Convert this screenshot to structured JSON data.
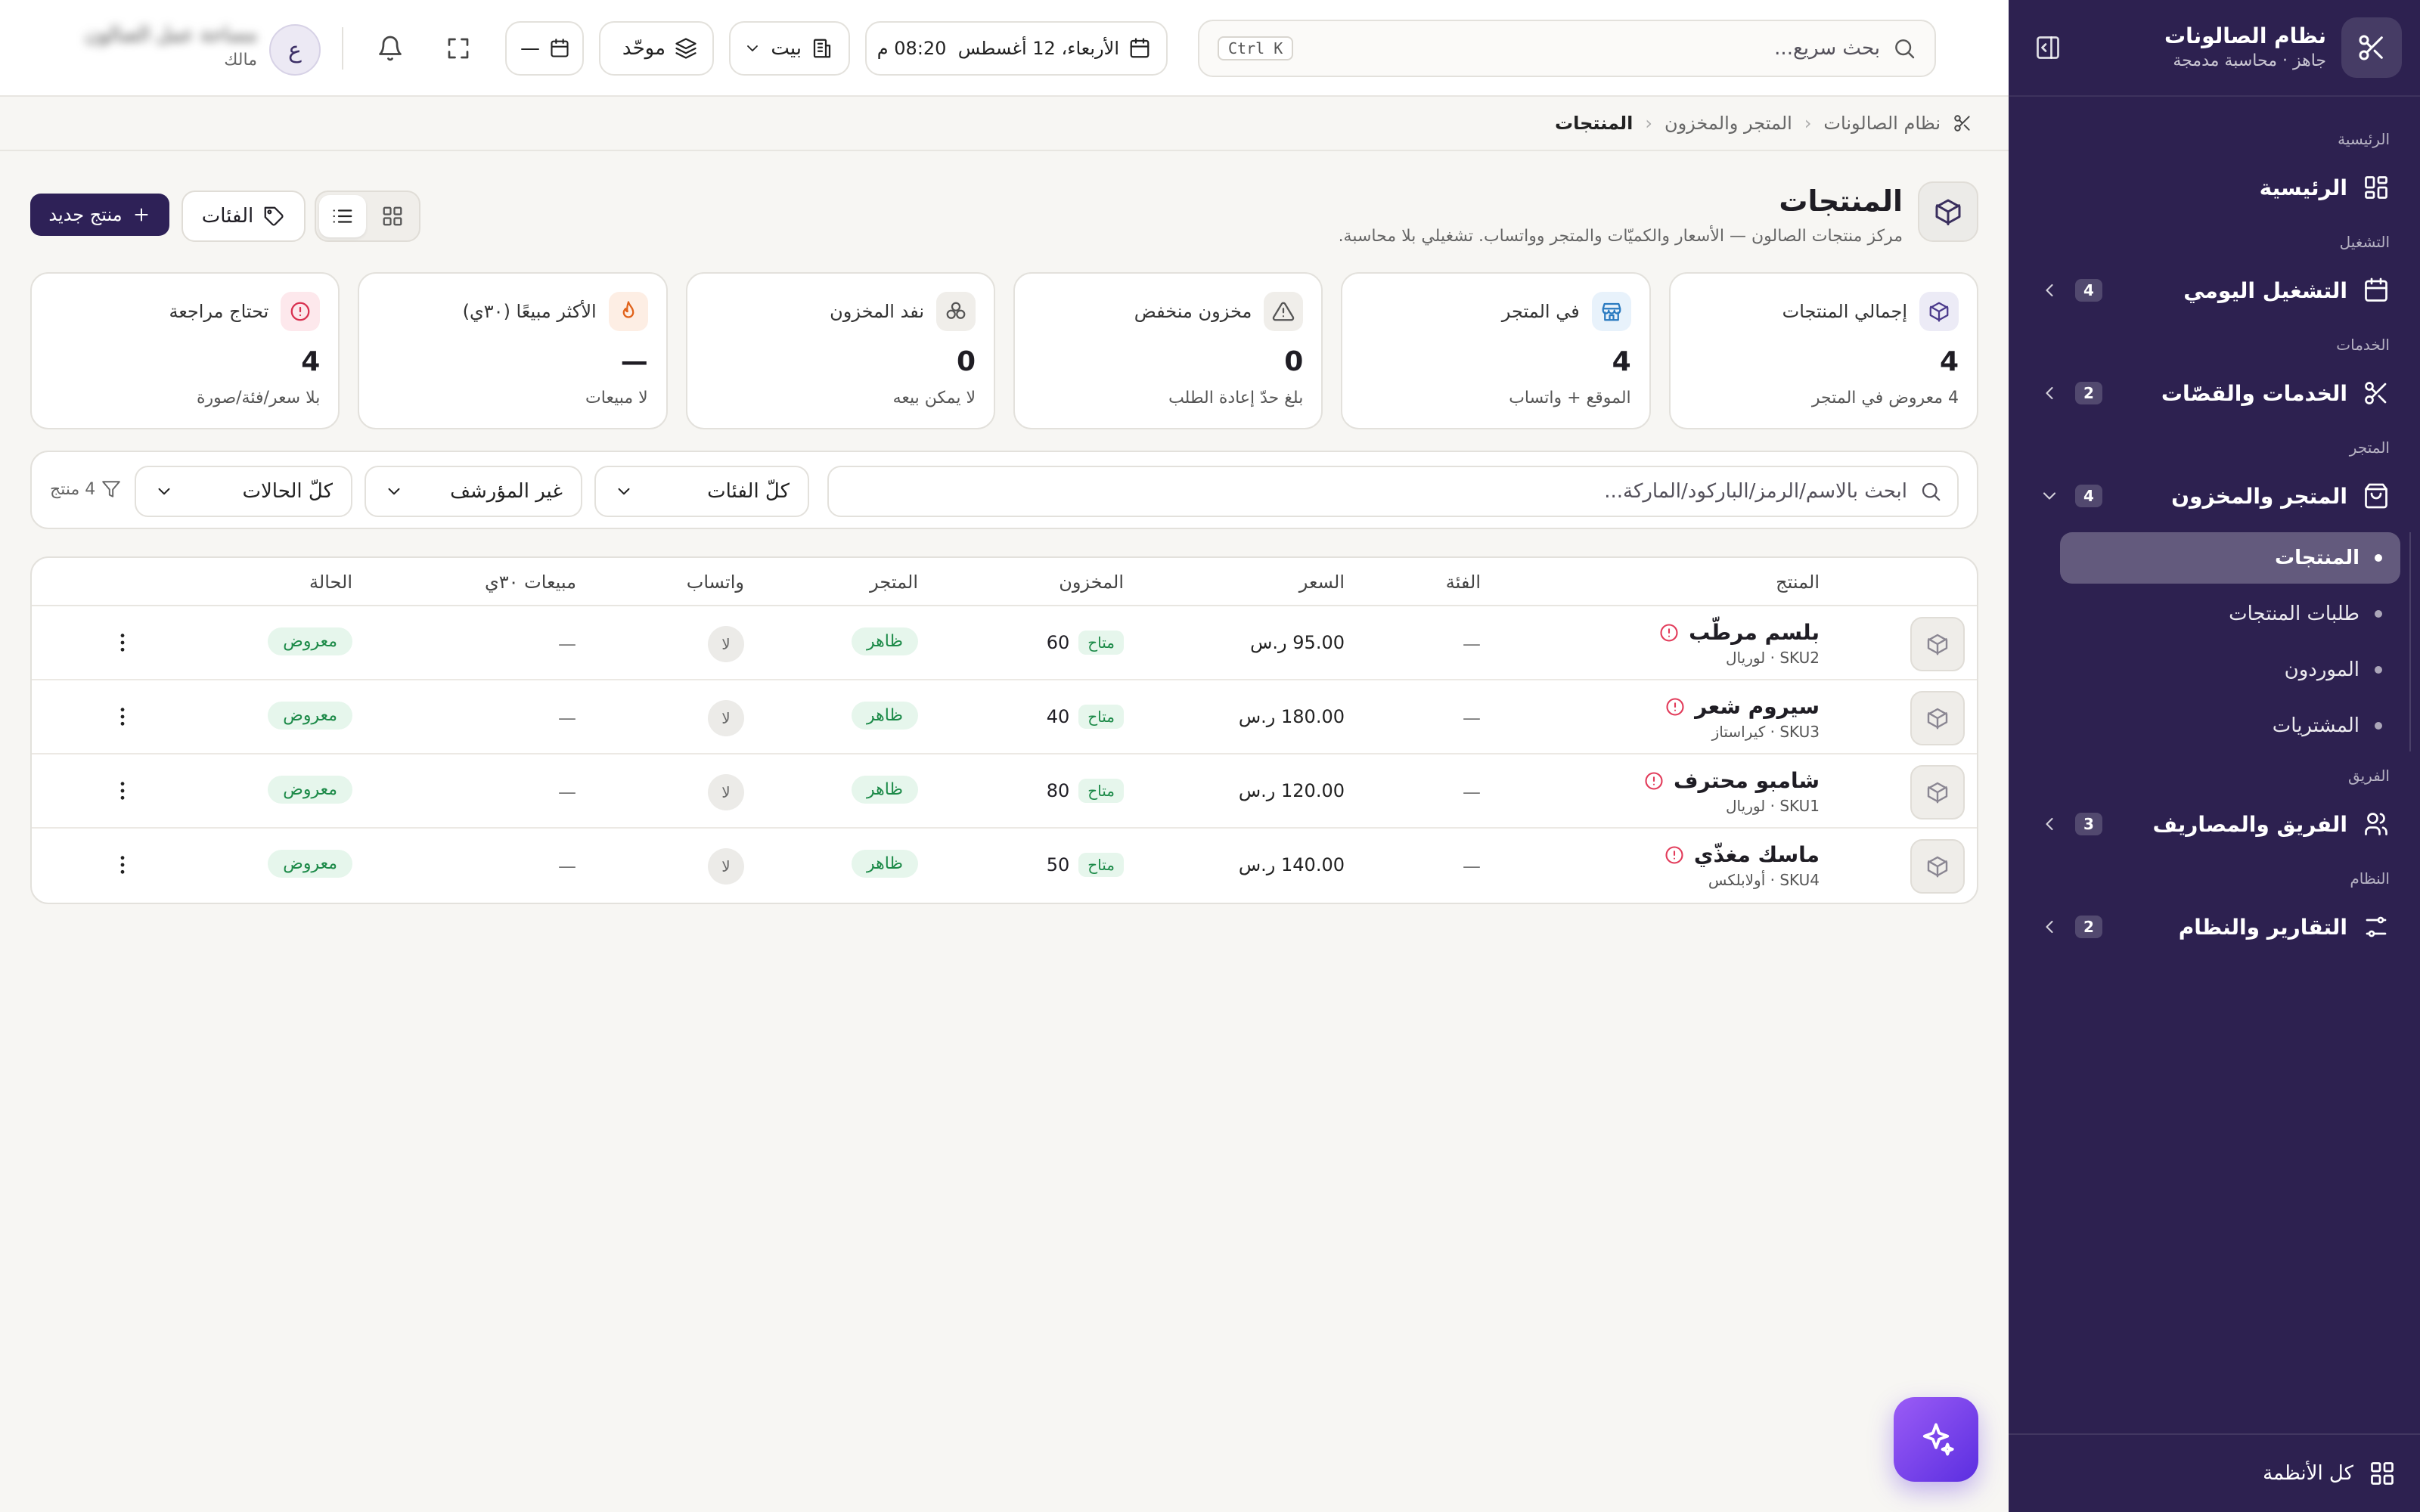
{
  "sidebar": {
    "brand_title": "نظام الصالونات",
    "brand_subtitle": "جاهز · محاسبة مدمجة",
    "sections": {
      "home": "الرئيسية",
      "ops": "التشغيل",
      "services": "الخدمات",
      "store": "المتجر",
      "team": "الفريق",
      "system": "النظام"
    },
    "items": {
      "home": {
        "label": "الرئيسية"
      },
      "daily": {
        "label": "التشغيل اليومي",
        "badge": "4"
      },
      "services": {
        "label": "الخدمات والقصّات",
        "badge": "2"
      },
      "store": {
        "label": "المتجر والمخزون",
        "badge": "4"
      },
      "team": {
        "label": "الفريق والمصاريف",
        "badge": "3"
      },
      "reports": {
        "label": "التقارير والنظام",
        "badge": "2"
      }
    },
    "store_sub": [
      "المنتجات",
      "طلبات المنتجات",
      "الموردون",
      "المشتريات"
    ],
    "footer": "كل الأنظمة"
  },
  "topbar": {
    "search_placeholder": "بحث سريع...",
    "shortcut": "Ctrl K",
    "datetime": "الأربعاء، 12 أغسطس  08:20 م",
    "branch": "بيت",
    "view_mode": "موحّد",
    "calendar_value": "—",
    "avatar_letter": "ع",
    "user_name": "مساحة عمل الصالون",
    "user_role": "مالك"
  },
  "breadcrumb": [
    "نظام الصالونات",
    "المتجر والمخزون",
    "المنتجات"
  ],
  "page": {
    "title": "المنتجات",
    "subtitle": "مركز منتجات الصالون — الأسعار والكميّات والمتجر وواتساب. تشغيلي بلا محاسبة.",
    "categories_button": "الفئات",
    "new_button": "منتج جديد"
  },
  "stats": [
    {
      "label": "إجمالي المنتجات",
      "value": "4",
      "sub": "4 معروض في المتجر",
      "icon": "box-icon",
      "color": "#4b3a8c",
      "bg": "#ecebf6"
    },
    {
      "label": "في المتجر",
      "value": "4",
      "sub": "الموقع + واتساب",
      "icon": "store-icon",
      "color": "#2a7ac0",
      "bg": "#e8f2fb"
    },
    {
      "label": "مخزون منخفض",
      "value": "0",
      "sub": "بلغ حدّ إعادة الطلب",
      "icon": "warning-icon",
      "color": "#555555",
      "bg": "#f0eeea"
    },
    {
      "label": "نفد المخزون",
      "value": "0",
      "sub": "لا يمكن بيعه",
      "icon": "boxes-icon",
      "color": "#555555",
      "bg": "#f0eeea"
    },
    {
      "label": "الأكثر مبيعًا (٣٠ي)",
      "value": "—",
      "sub": "لا مبيعات",
      "icon": "flame-icon",
      "color": "#e0621a",
      "bg": "#fdeee4"
    },
    {
      "label": "تحتاج مراجعة",
      "value": "4",
      "sub": "بلا سعر/فئة/صورة",
      "icon": "alert-icon",
      "color": "#d8304f",
      "bg": "#fde8ec"
    }
  ],
  "filters": {
    "search_placeholder": "ابحث بالاسم/الرمز/الباركود/الماركة...",
    "category": "كلّ الفئات",
    "archived": "غير المؤرشف",
    "status": "كلّ الحالات",
    "count": "4 منتج"
  },
  "table": {
    "headers": {
      "product": "المنتج",
      "category": "الفئة",
      "price": "السعر",
      "stock": "المخزون",
      "store": "المتجر",
      "whatsapp": "واتساب",
      "sales": "مبيعات ٣٠ي",
      "status": "الحالة"
    },
    "rows": [
      {
        "name": "بلسم مرطّب",
        "sku": "SKU2 · لوريال",
        "category": "—",
        "price": "95.00 ر.س",
        "stock": "60",
        "stock_tag": "متاح",
        "store": "ظاهر",
        "whatsapp": "لا",
        "sales": "—",
        "status": "معروض"
      },
      {
        "name": "سيروم شعر",
        "sku": "SKU3 · كيراستاز",
        "category": "—",
        "price": "180.00 ر.س",
        "stock": "40",
        "stock_tag": "متاح",
        "store": "ظاهر",
        "whatsapp": "لا",
        "sales": "—",
        "status": "معروض"
      },
      {
        "name": "شامبو محترف",
        "sku": "SKU1 · لوريال",
        "category": "—",
        "price": "120.00 ر.س",
        "stock": "80",
        "stock_tag": "متاح",
        "store": "ظاهر",
        "whatsapp": "لا",
        "sales": "—",
        "status": "معروض"
      },
      {
        "name": "ماسك مغذّي",
        "sku": "SKU4 · أولابلكس",
        "category": "—",
        "price": "140.00 ر.س",
        "stock": "50",
        "stock_tag": "متاح",
        "store": "ظاهر",
        "whatsapp": "لا",
        "sales": "—",
        "status": "معروض"
      }
    ]
  }
}
